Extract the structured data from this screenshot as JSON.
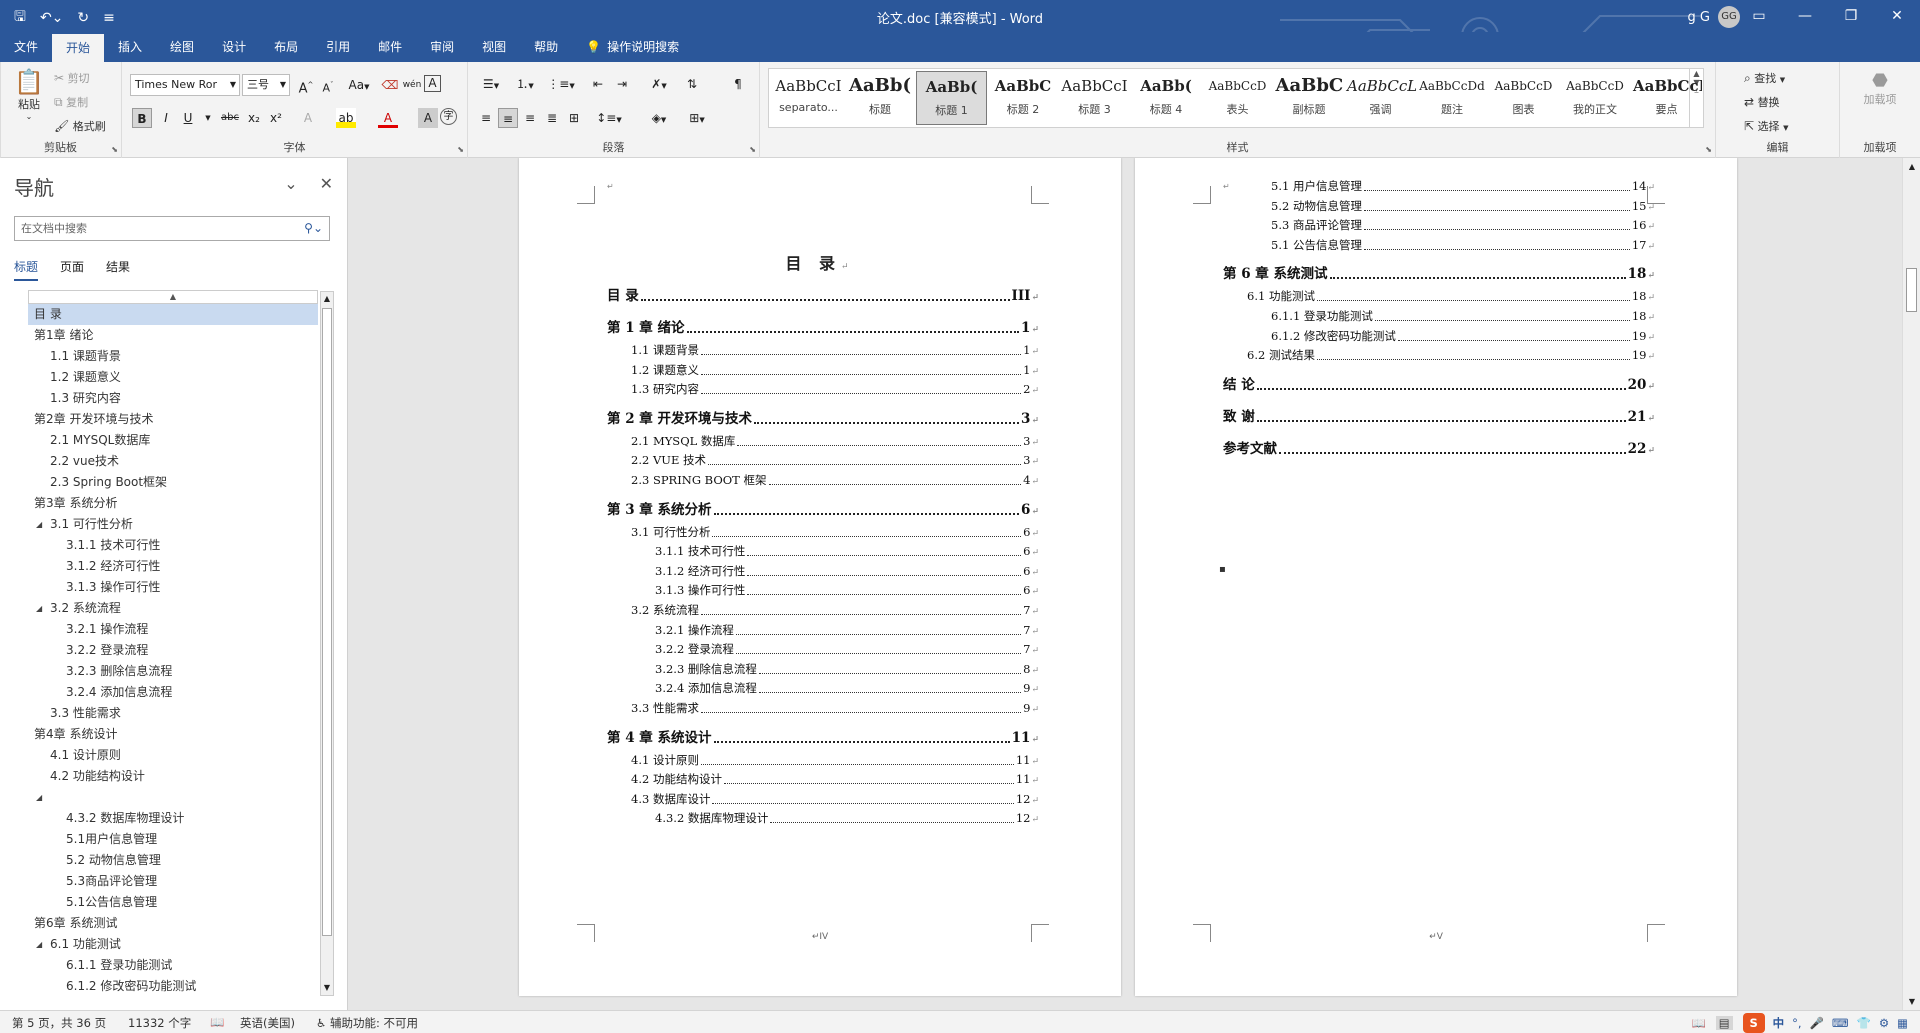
{
  "titlebar": {
    "title": "论文.doc [兼容模式]  -  Word",
    "user_name": "g G",
    "avatar_initials": "GG"
  },
  "tabs": [
    "文件",
    "开始",
    "插入",
    "绘图",
    "设计",
    "布局",
    "引用",
    "邮件",
    "审阅",
    "视图",
    "帮助"
  ],
  "active_tab": "开始",
  "tell_me": "操作说明搜索",
  "ribbon": {
    "clipboard": {
      "label": "剪贴板",
      "paste": "粘贴",
      "cut": "剪切",
      "copy": "复制",
      "format_painter": "格式刷"
    },
    "font": {
      "label": "字体",
      "font_name": "Times New Ror",
      "font_size": "三号",
      "bold": "B",
      "italic": "I",
      "underline": "U",
      "strike": "abc",
      "sub": "x₂",
      "sup": "x²",
      "grow": "A",
      "shrink": "A",
      "case": "Aa",
      "wen": "wén",
      "boxA": "A"
    },
    "paragraph": {
      "label": "段落"
    },
    "styles": {
      "label": "样式",
      "items": [
        {
          "preview": "AaBbCcI",
          "name": "separato..."
        },
        {
          "preview": "AaBb(",
          "name": "标题"
        },
        {
          "preview": "AaBb(",
          "name": "标题 1"
        },
        {
          "preview": "AaBbC",
          "name": "标题 2"
        },
        {
          "preview": "AaBbCcI",
          "name": "标题 3"
        },
        {
          "preview": "AaBb(",
          "name": "标题 4"
        },
        {
          "preview": "AaBbCcD",
          "name": "表头"
        },
        {
          "preview": "AaBbC",
          "name": "副标题"
        },
        {
          "preview": "AaBbCcL",
          "name": "强调"
        },
        {
          "preview": "AaBbCcDd",
          "name": "题注"
        },
        {
          "preview": "AaBbCcD",
          "name": "图表"
        },
        {
          "preview": "AaBbCcD",
          "name": "我的正文"
        },
        {
          "preview": "AaBbCcI",
          "name": "要点"
        }
      ],
      "selected_index": 2
    },
    "editing": {
      "label": "编辑",
      "find": "查找",
      "replace": "替换",
      "select": "选择"
    },
    "addins": {
      "label": "加载项",
      "button": "加载项"
    }
  },
  "nav": {
    "title": "导航",
    "search_placeholder": "在文档中搜索",
    "tabs": [
      "标题",
      "页面",
      "结果"
    ],
    "active_tab": "标题",
    "items": [
      {
        "text": "目  录",
        "level": 0,
        "expander": "",
        "highlight": true
      },
      {
        "text": "第1章 绪论",
        "level": 0,
        "expander": "◢"
      },
      {
        "text": "1.1 课题背景",
        "level": 1,
        "expander": ""
      },
      {
        "text": "1.2 课题意义",
        "level": 1,
        "expander": ""
      },
      {
        "text": "1.3 研究内容",
        "level": 1,
        "expander": ""
      },
      {
        "text": "第2章 开发环境与技术",
        "level": 0,
        "expander": "◢"
      },
      {
        "text": "2.1 MYSQL数据库",
        "level": 1,
        "expander": ""
      },
      {
        "text": "2.2 vue技术",
        "level": 1,
        "expander": ""
      },
      {
        "text": "2.3 Spring Boot框架",
        "level": 1,
        "expander": ""
      },
      {
        "text": "第3章 系统分析",
        "level": 0,
        "expander": "◢"
      },
      {
        "text": "3.1 可行性分析",
        "level": 1,
        "expander": "◢"
      },
      {
        "text": "3.1.1 技术可行性",
        "level": 2,
        "expander": ""
      },
      {
        "text": "3.1.2 经济可行性",
        "level": 2,
        "expander": ""
      },
      {
        "text": "3.1.3 操作可行性",
        "level": 2,
        "expander": ""
      },
      {
        "text": "3.2 系统流程",
        "level": 1,
        "expander": "◢"
      },
      {
        "text": "3.2.1 操作流程",
        "level": 2,
        "expander": ""
      },
      {
        "text": "3.2.2 登录流程",
        "level": 2,
        "expander": ""
      },
      {
        "text": "3.2.3 删除信息流程",
        "level": 2,
        "expander": ""
      },
      {
        "text": "3.2.4 添加信息流程",
        "level": 2,
        "expander": ""
      },
      {
        "text": "3.3 性能需求",
        "level": 1,
        "expander": ""
      },
      {
        "text": "第4章 系统设计",
        "level": 0,
        "expander": "◢"
      },
      {
        "text": "4.1 设计原则",
        "level": 1,
        "expander": ""
      },
      {
        "text": "4.2 功能结构设计",
        "level": 1,
        "expander": ""
      },
      {
        "text": "",
        "level": 1,
        "expander": "◢"
      },
      {
        "text": "4.3.2 数据库物理设计",
        "level": 2,
        "expander": ""
      },
      {
        "text": "5.1用户信息管理",
        "level": 2,
        "expander": ""
      },
      {
        "text": "5.2  动物信息管理",
        "level": 2,
        "expander": ""
      },
      {
        "text": "5.3商品评论管理",
        "level": 2,
        "expander": ""
      },
      {
        "text": "5.1公告信息管理",
        "level": 2,
        "expander": ""
      },
      {
        "text": "第6章 系统测试",
        "level": 0,
        "expander": "◢"
      },
      {
        "text": "6.1  功能测试",
        "level": 1,
        "expander": "◢"
      },
      {
        "text": "6.1.1  登录功能测试",
        "level": 2,
        "expander": ""
      },
      {
        "text": "6.1.2 修改密码功能测试",
        "level": 2,
        "expander": ""
      }
    ]
  },
  "page1": {
    "title": "目  录",
    "footer": "IV",
    "entries": [
      {
        "text": "目    录",
        "page": "III",
        "level": 0
      },
      {
        "text": "第 1 章  绪论",
        "page": "1",
        "level": 0
      },
      {
        "text": "1.1 课题背景",
        "page": "1",
        "level": 1
      },
      {
        "text": "1.2 课题意义",
        "page": "1",
        "level": 1
      },
      {
        "text": "1.3 研究内容",
        "page": "2",
        "level": 1
      },
      {
        "text": "第 2 章  开发环境与技术",
        "page": "3",
        "level": 0
      },
      {
        "text": "2.1 MYSQL 数据库",
        "page": "3",
        "level": 1
      },
      {
        "text": "2.2 VUE 技术",
        "page": "3",
        "level": 1
      },
      {
        "text": "2.3 SPRING BOOT 框架",
        "page": "4",
        "level": 1
      },
      {
        "text": "第 3 章  系统分析",
        "page": "6",
        "level": 0
      },
      {
        "text": "3.1 可行性分析",
        "page": "6",
        "level": 1
      },
      {
        "text": "3.1.1  技术可行性",
        "page": "6",
        "level": 2
      },
      {
        "text": "3.1.2  经济可行性",
        "page": "6",
        "level": 2
      },
      {
        "text": "3.1.3  操作可行性",
        "page": "6",
        "level": 2
      },
      {
        "text": "3.2 系统流程",
        "page": "7",
        "level": 1
      },
      {
        "text": "3.2.1  操作流程",
        "page": "7",
        "level": 2
      },
      {
        "text": "3.2.2  登录流程",
        "page": "7",
        "level": 2
      },
      {
        "text": "3.2.3  删除信息流程",
        "page": "8",
        "level": 2
      },
      {
        "text": "3.2.4  添加信息流程",
        "page": "9",
        "level": 2
      },
      {
        "text": "3.3 性能需求",
        "page": "9",
        "level": 1
      },
      {
        "text": "第 4 章  系统设计",
        "page": "11",
        "level": 0
      },
      {
        "text": "4.1 设计原则",
        "page": "11",
        "level": 1
      },
      {
        "text": "4.2 功能结构设计",
        "page": "11",
        "level": 1
      },
      {
        "text": "4.3 数据库设计",
        "page": "12",
        "level": 1
      },
      {
        "text": "4.3.2  数据库物理设计",
        "page": "12",
        "level": 2
      }
    ]
  },
  "page2": {
    "footer": "V",
    "entries": [
      {
        "text": "5.1 用户信息管理",
        "page": "14",
        "level": 2
      },
      {
        "text": "5.2  动物信息管理",
        "page": "15",
        "level": 2
      },
      {
        "text": "5.3 商品评论管理",
        "page": "16",
        "level": 2
      },
      {
        "text": "5.1 公告信息管理",
        "page": "17",
        "level": 2
      },
      {
        "text": "第 6 章  系统测试",
        "page": "18",
        "level": 0
      },
      {
        "text": "6.1  功能测试",
        "page": "18",
        "level": 1
      },
      {
        "text": "6.1.1  登录功能测试",
        "page": "18",
        "level": 2
      },
      {
        "text": "6.1.2  修改密码功能测试",
        "page": "19",
        "level": 2
      },
      {
        "text": "6.2 测试结果",
        "page": "19",
        "level": 1
      },
      {
        "text": "结    论",
        "page": "20",
        "level": 0
      },
      {
        "text": "致    谢",
        "page": "21",
        "level": 0
      },
      {
        "text": "参考文献",
        "page": "22",
        "level": 0
      }
    ]
  },
  "status": {
    "page": "第 5 页，共 36 页",
    "words": "11332 个字",
    "language": "英语(美国)",
    "accessibility": "辅助功能: 不可用",
    "ime_lang": "中"
  },
  "colors": {
    "accent": "#2b579a",
    "nav_highlight": "#c9daf0",
    "sogou": "#e8541e"
  }
}
